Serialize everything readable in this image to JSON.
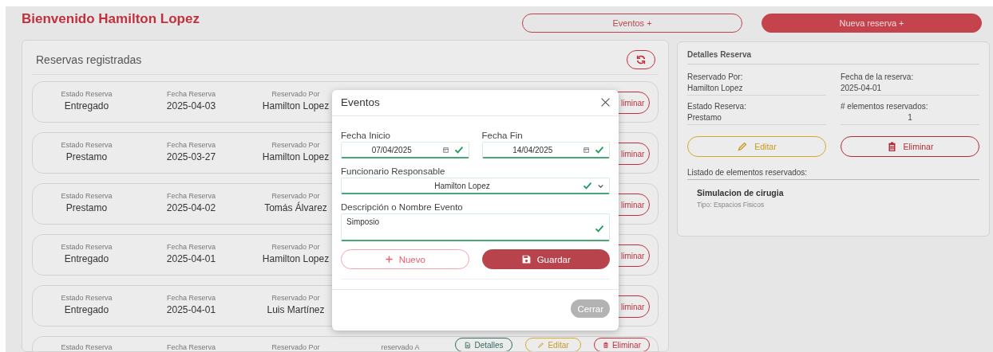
{
  "header": {
    "title": "Bienvenido Hamilton Lopez",
    "buttons": [
      {
        "kind": "outline",
        "label": "Eventos +"
      },
      {
        "kind": "filled",
        "label": "Nueva reserva +"
      }
    ]
  },
  "reservas": {
    "title": "Reservas registradas",
    "rows": [
      {
        "estado_label": "Estado Reserva",
        "estado": "Entregado",
        "fecha_label": "Fecha Reserva",
        "fecha": "2025-04-03",
        "por_label": "Reservado Por",
        "por": "Hamilton Lopez",
        "actions": [
          {
            "kind": "delete",
            "label": "liminar"
          }
        ]
      },
      {
        "estado_label": "Estado Reserva",
        "estado": "Prestamo",
        "fecha_label": "Fecha Reserva",
        "fecha": "2025-03-27",
        "por_label": "Reservado Por",
        "por": "Hamilton Lopez",
        "actions": [
          {
            "kind": "delete",
            "label": "liminar"
          }
        ]
      },
      {
        "estado_label": "Estado Reserva",
        "estado": "Prestamo",
        "fecha_label": "Fecha Reserva",
        "fecha": "2025-04-02",
        "por_label": "Reservado Por",
        "por": "Tomás Álvarez",
        "actions": [
          {
            "kind": "delete",
            "label": "liminar"
          }
        ]
      },
      {
        "estado_label": "Estado Reserva",
        "estado": "Entregado",
        "fecha_label": "Fecha Reserva",
        "fecha": "2025-04-01",
        "por_label": "Reservado Por",
        "por": "Hamilton Lopez",
        "actions": [
          {
            "kind": "delete",
            "label": "liminar"
          }
        ]
      },
      {
        "estado_label": "Estado Reserva",
        "estado": "Entregado",
        "fecha_label": "Fecha Reserva",
        "fecha": "2025-04-01",
        "por_label": "Reservado Por",
        "por": "Luis Martínez",
        "actions": [
          {
            "kind": "delete",
            "label": "liminar"
          }
        ]
      },
      {
        "estado_label": "Estado Reserva",
        "fecha_label": "Fecha Reserva",
        "por_label": "Reservado Por",
        "column_4_label": "reservado A",
        "actions": [
          {
            "kind": "details",
            "label": "Detalles"
          },
          {
            "kind": "edit",
            "label": "Editar"
          },
          {
            "kind": "delete",
            "label": "Eliminar"
          }
        ]
      }
    ]
  },
  "details": {
    "title": "Detalles Reserva",
    "fields": [
      {
        "kind": "text",
        "label": "Reservado Por:",
        "value": "Hamilton Lopez"
      },
      {
        "kind": "text",
        "label": "Fecha de la reserva:",
        "value": "2025-04-01"
      },
      {
        "kind": "text",
        "label": "Estado Reserva:",
        "value": "Prestamo"
      },
      {
        "kind": "count",
        "label": "# elementos reservados:",
        "value": "1"
      }
    ],
    "buttons": [
      {
        "kind": "edit",
        "label": "Editar"
      },
      {
        "kind": "delete",
        "label": "Eliminar"
      }
    ],
    "list_title": "Listado de elementos reservados:",
    "items": [
      {
        "name": "Simulacion de cirugia",
        "type": "Tipo: Espacios Fisicos"
      }
    ]
  },
  "modal": {
    "title": "Eventos",
    "fields": [
      {
        "kind": "date",
        "label": "Fecha Inicio",
        "value": "07/04/2025",
        "valid": true
      },
      {
        "kind": "date",
        "label": "Fecha Fin",
        "value": "14/04/2025",
        "valid": true
      },
      {
        "kind": "select",
        "label": "Funcionario Responsable",
        "value": "Hamilton Lopez",
        "valid": true
      },
      {
        "kind": "textarea",
        "label": "Descripción o Nombre Evento",
        "value": "Simposio",
        "valid": true
      }
    ],
    "actions": [
      {
        "kind": "new",
        "label": "Nuevo"
      },
      {
        "kind": "save",
        "label": "Guardar"
      }
    ],
    "footer_button": "Cerrar"
  }
}
